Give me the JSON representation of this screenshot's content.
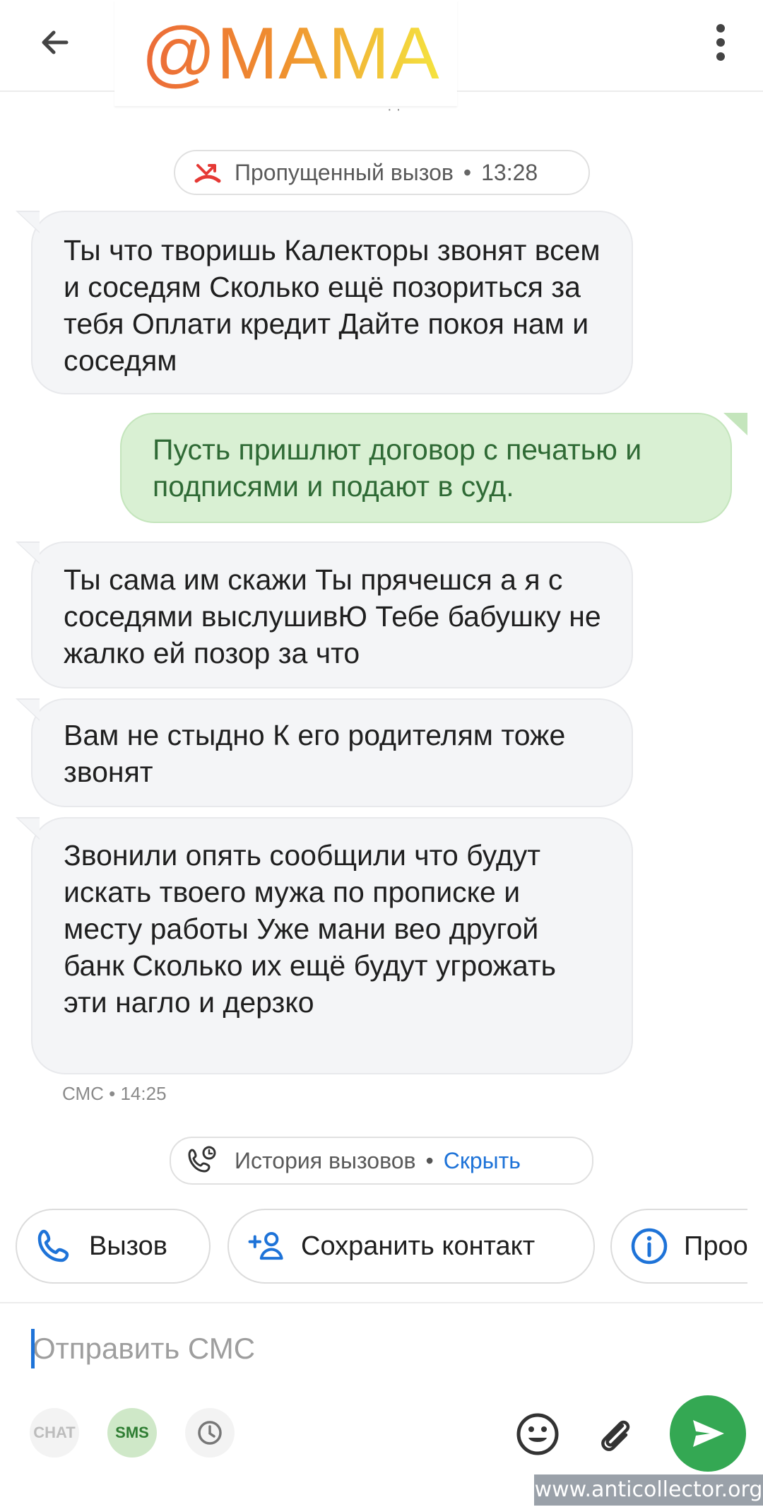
{
  "header": {
    "title": "@МАМА",
    "back_icon": "arrow-left-icon",
    "more_icon": "more-vert-icon"
  },
  "missed_call": {
    "icon": "missed-call-icon",
    "label": "Пропущенный вызов",
    "separator": "•",
    "time": "13:28"
  },
  "messages": [
    {
      "direction": "incoming",
      "text": "Ты что творишь Калекторы звонят всем и соседям Сколько ещё позориться за тебя Оплати кредит Дайте покоя нам и соседям"
    },
    {
      "direction": "outgoing",
      "text": "Пусть пришлют договор с печатью и подписями и подают в суд."
    },
    {
      "direction": "incoming",
      "text": "Ты сама им скажи Ты прячешся а я с соседями выслушивЮ Тебе бабушку не жалко ей позор за что"
    },
    {
      "direction": "incoming",
      "text": "Вам не стыдно К его родителям тоже звонят"
    },
    {
      "direction": "incoming",
      "text": "Звонили опять сообщили что будут искать твоего мужа по прописке и месту работы Уже мани вео другой банк Сколько их ещё будут угрожать эти нагло и дерзко"
    }
  ],
  "last_meta": "СМС • 14:25",
  "call_history": {
    "icon": "call-history-icon",
    "label": "История вызовов",
    "separator": "•",
    "link": "Скрыть"
  },
  "actions": [
    {
      "icon": "phone-icon",
      "label": "Вызов"
    },
    {
      "icon": "add-contact-icon",
      "label": "Сохранить контакт"
    },
    {
      "icon": "info-icon",
      "label": "Проо"
    }
  ],
  "composer": {
    "placeholder": "Отправить СМС",
    "modes": [
      {
        "label": "CHAT"
      },
      {
        "label": "SMS"
      },
      {
        "icon": "clock-icon"
      }
    ],
    "emoji_icon": "emoji-icon",
    "attach_icon": "paperclip-icon",
    "send_icon": "send-icon"
  },
  "colors": {
    "accent_blue": "#1e73d8",
    "send_green": "#34a853",
    "outgoing_bubble": "#d9f0d3",
    "outgoing_text": "#2f6a35",
    "incoming_bubble": "#f4f5f7",
    "missed_red": "#e53935"
  },
  "watermark": "www.anticollector.org"
}
